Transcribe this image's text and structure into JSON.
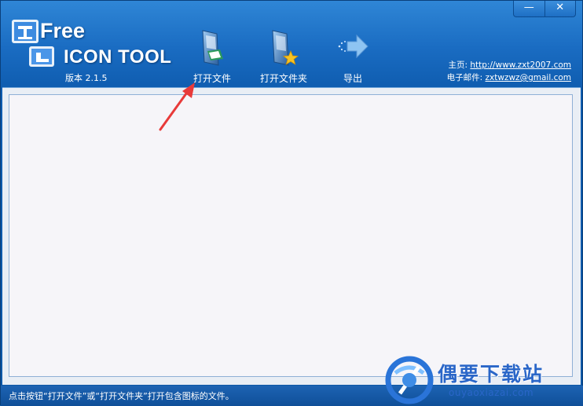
{
  "window": {
    "controls": {
      "minimize": "—",
      "close": "✕"
    }
  },
  "logo": {
    "line1": "Free",
    "line2": "ICON TOOL",
    "version": "版本 2.1.5"
  },
  "toolbar": {
    "open_file": "打开文件",
    "open_folder": "打开文件夹",
    "export": "导出"
  },
  "links": {
    "homepage_label": "主页:",
    "homepage_url": "http://www.zxt2007.com",
    "email_label": "电子邮件:",
    "email": "zxtwzwz@gmail.com"
  },
  "status": {
    "text": "点击按钮“打开文件”或“打开文件夹”打开包含图标的文件。"
  },
  "watermark": {
    "name": "偶要下载站",
    "url": "ouyaoxiazai.com"
  },
  "colors": {
    "header_blue": "#1a6cc2",
    "annotation_red": "#e83a3a"
  }
}
